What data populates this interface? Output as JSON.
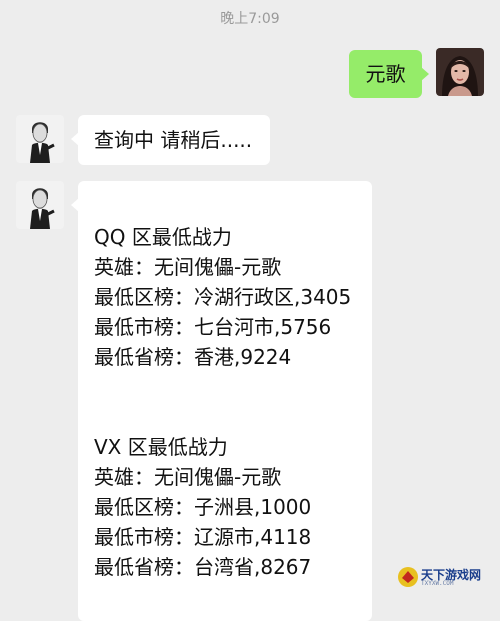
{
  "status": {
    "time": "晚上7:09"
  },
  "messages": [
    {
      "sender": "self",
      "text": "元歌"
    },
    {
      "sender": "bot",
      "text": "查询中 请稍后....."
    },
    {
      "sender": "bot",
      "lines": [
        "QQ 区最低战力",
        "英雄：无间傀儡-元歌",
        "最低区榜：冷湖行政区,3405",
        "最低市榜：七台河市,5756",
        "最低省榜：香港,9224",
        "",
        "",
        "VX 区最低战力",
        "英雄：无间傀儡-元歌",
        "最低区榜：子洲县,1000",
        "最低市榜：辽源市,4118",
        "最低省榜：台湾省,8267"
      ]
    }
  ],
  "watermark": {
    "title": "天下游戏网",
    "sub": "TXYXW.COM"
  },
  "colors": {
    "background": "#ededed",
    "self_bubble": "#95ec69",
    "bot_bubble": "#ffffff",
    "timestamp": "#9a9a9a"
  },
  "icons": {
    "self_avatar": "girl-photo-avatar",
    "bot_avatar": "sketch-man-avatar",
    "watermark_logo": "game-site-logo"
  }
}
